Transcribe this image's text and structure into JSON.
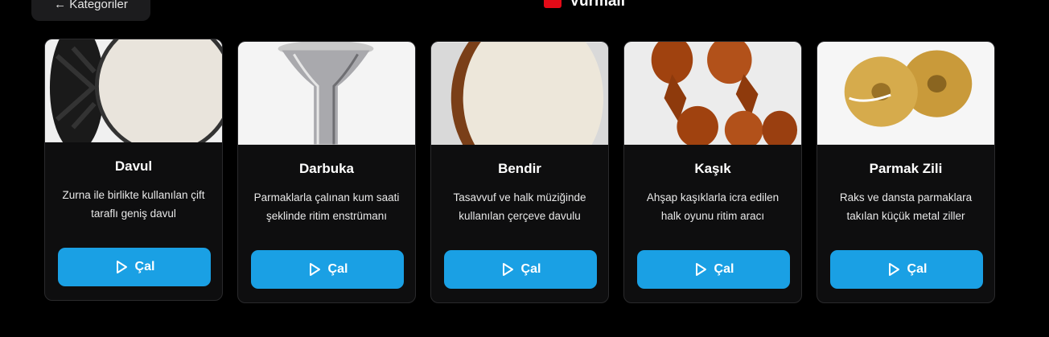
{
  "header": {
    "back_label": "← Kategoriler",
    "title": "Vurmalı"
  },
  "cards": [
    {
      "title": "Davul",
      "desc": "Zurna ile birlikte kullanılan çift taraflı geniş davul",
      "play": "Çal"
    },
    {
      "title": "Darbuka",
      "desc": "Parmaklarla çalınan kum saati şeklinde ritim enstrümanı",
      "play": "Çal"
    },
    {
      "title": "Bendir",
      "desc": "Tasavvuf ve halk müziğinde kullanılan çerçeve davulu",
      "play": "Çal"
    },
    {
      "title": "Kaşık",
      "desc": "Ahşap kaşıklarla icra edilen halk oyunu ritim aracı",
      "play": "Çal"
    },
    {
      "title": "Parmak Zili",
      "desc": "Raks ve dansta parmaklara takılan küçük metal ziller",
      "play": "Çal"
    }
  ],
  "colors": {
    "accent": "#1aa0e4",
    "card_bg": "#0e0e0f",
    "page_bg": "#000000",
    "flag": "#e30a17"
  }
}
